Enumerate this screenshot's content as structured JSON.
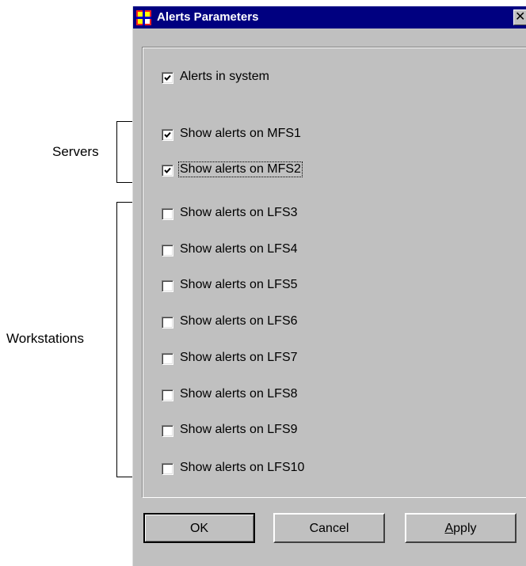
{
  "window": {
    "title": "Alerts Parameters",
    "close_glyph": "✕"
  },
  "annotations": {
    "servers": "Servers",
    "workstations": "Workstations"
  },
  "checkboxes": [
    {
      "label": "Alerts in system",
      "checked": true
    },
    {
      "label": "Show alerts on MFS1",
      "checked": true
    },
    {
      "label": "Show alerts on MFS2",
      "checked": true,
      "focused": true
    },
    {
      "label": "Show alerts on LFS3",
      "checked": false
    },
    {
      "label": "Show alerts on LFS4",
      "checked": false
    },
    {
      "label": "Show alerts on LFS5",
      "checked": false
    },
    {
      "label": "Show alerts on LFS6",
      "checked": false
    },
    {
      "label": "Show alerts on LFS7",
      "checked": false
    },
    {
      "label": "Show alerts on LFS8",
      "checked": false
    },
    {
      "label": "Show alerts on LFS9",
      "checked": false
    },
    {
      "label": "Show alerts on LFS10",
      "checked": false
    }
  ],
  "buttons": {
    "ok": "OK",
    "cancel": "Cancel",
    "apply_prefix": "",
    "apply_accel": "A",
    "apply_rest": "pply"
  },
  "colors": {
    "titlebar": "#000080",
    "dialog_face": "#c0c0c0"
  }
}
